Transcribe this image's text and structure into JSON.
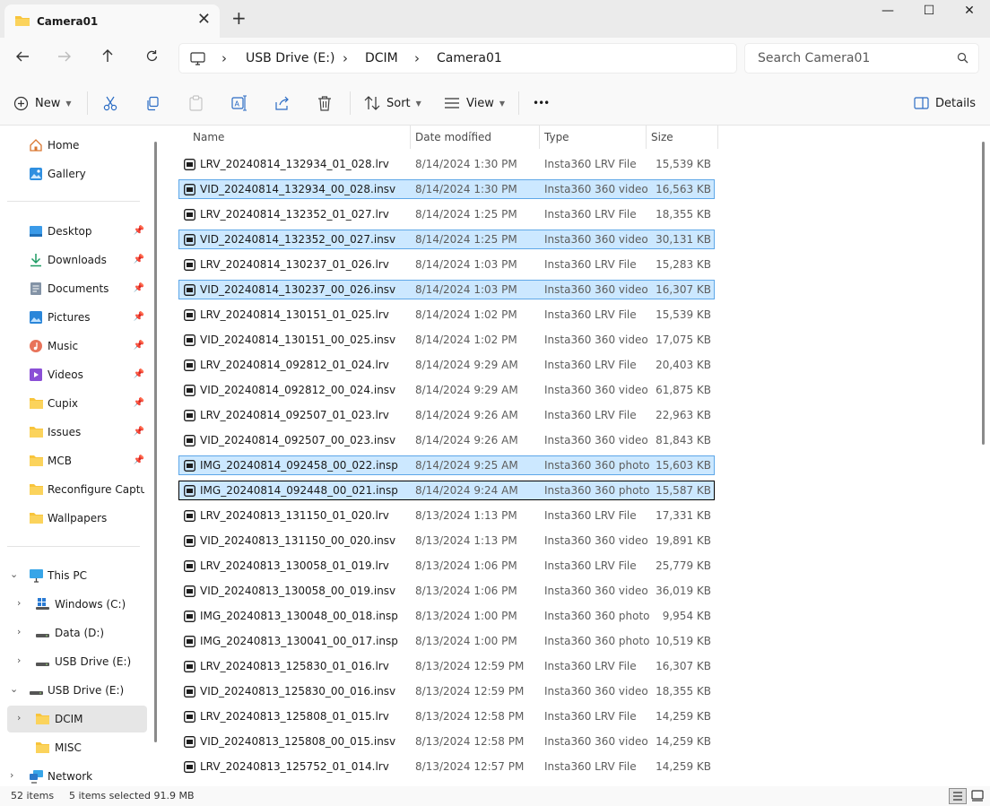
{
  "window": {
    "tab_title": "Camera01",
    "new_tab_glyph": "+",
    "close_glyph": "✕",
    "minimize": "—",
    "maximize": "☐",
    "close": "✕"
  },
  "address": {
    "crumbs": [
      "USB Drive (E:)",
      "DCIM",
      "Camera01"
    ],
    "search_placeholder": "Search Camera01"
  },
  "commands": {
    "new": "New",
    "sort": "Sort",
    "view": "View",
    "more": "•••",
    "details": "Details"
  },
  "nav": {
    "quick": [
      {
        "label": "Home",
        "icon": "home-icon"
      },
      {
        "label": "Gallery",
        "icon": "gallery-icon"
      }
    ],
    "pinned": [
      {
        "label": "Desktop",
        "icon": "desktop-icon"
      },
      {
        "label": "Downloads",
        "icon": "download-icon"
      },
      {
        "label": "Documents",
        "icon": "documents-icon"
      },
      {
        "label": "Pictures",
        "icon": "pictures-icon"
      },
      {
        "label": "Music",
        "icon": "music-icon"
      },
      {
        "label": "Videos",
        "icon": "videos-icon"
      },
      {
        "label": "Cupix",
        "icon": "folder-icon"
      },
      {
        "label": "Issues",
        "icon": "folder-icon"
      },
      {
        "label": "MCB",
        "icon": "folder-icon"
      },
      {
        "label": "Reconfigure Captu",
        "icon": "folder-icon"
      },
      {
        "label": "Wallpapers",
        "icon": "folder-icon"
      }
    ],
    "tree": [
      {
        "label": "This PC",
        "icon": "pc-icon"
      },
      {
        "label": "Windows (C:)",
        "icon": "windows-drive-icon"
      },
      {
        "label": "Data (D:)",
        "icon": "drive-icon"
      },
      {
        "label": "USB Drive (E:)",
        "icon": "drive-icon"
      },
      {
        "label": "USB Drive (E:)",
        "icon": "drive-icon"
      },
      {
        "label": "DCIM",
        "icon": "folder-icon"
      },
      {
        "label": "MISC",
        "icon": "folder-icon"
      },
      {
        "label": "Network",
        "icon": "network-icon"
      }
    ]
  },
  "columns": {
    "name": "Name",
    "date": "Date modified",
    "type": "Type",
    "size": "Size"
  },
  "files": [
    {
      "name": "LRV_20240814_132934_01_028.lrv",
      "date": "8/14/2024 1:30 PM",
      "type": "Insta360 LRV File",
      "size": "15,539 KB",
      "state": ""
    },
    {
      "name": "VID_20240814_132934_00_028.insv",
      "date": "8/14/2024 1:30 PM",
      "type": "Insta360 360 video",
      "size": "16,563 KB",
      "state": "sel"
    },
    {
      "name": "LRV_20240814_132352_01_027.lrv",
      "date": "8/14/2024 1:25 PM",
      "type": "Insta360 LRV File",
      "size": "18,355 KB",
      "state": ""
    },
    {
      "name": "VID_20240814_132352_00_027.insv",
      "date": "8/14/2024 1:25 PM",
      "type": "Insta360 360 video",
      "size": "30,131 KB",
      "state": "sel"
    },
    {
      "name": "LRV_20240814_130237_01_026.lrv",
      "date": "8/14/2024 1:03 PM",
      "type": "Insta360 LRV File",
      "size": "15,283 KB",
      "state": ""
    },
    {
      "name": "VID_20240814_130237_00_026.insv",
      "date": "8/14/2024 1:03 PM",
      "type": "Insta360 360 video",
      "size": "16,307 KB",
      "state": "sel"
    },
    {
      "name": "LRV_20240814_130151_01_025.lrv",
      "date": "8/14/2024 1:02 PM",
      "type": "Insta360 LRV File",
      "size": "15,539 KB",
      "state": ""
    },
    {
      "name": "VID_20240814_130151_00_025.insv",
      "date": "8/14/2024 1:02 PM",
      "type": "Insta360 360 video",
      "size": "17,075 KB",
      "state": ""
    },
    {
      "name": "LRV_20240814_092812_01_024.lrv",
      "date": "8/14/2024 9:29 AM",
      "type": "Insta360 LRV File",
      "size": "20,403 KB",
      "state": ""
    },
    {
      "name": "VID_20240814_092812_00_024.insv",
      "date": "8/14/2024 9:29 AM",
      "type": "Insta360 360 video",
      "size": "61,875 KB",
      "state": ""
    },
    {
      "name": "LRV_20240814_092507_01_023.lrv",
      "date": "8/14/2024 9:26 AM",
      "type": "Insta360 LRV File",
      "size": "22,963 KB",
      "state": ""
    },
    {
      "name": "VID_20240814_092507_00_023.insv",
      "date": "8/14/2024 9:26 AM",
      "type": "Insta360 360 video",
      "size": "81,843 KB",
      "state": ""
    },
    {
      "name": "IMG_20240814_092458_00_022.insp",
      "date": "8/14/2024 9:25 AM",
      "type": "Insta360 360 photo",
      "size": "15,603 KB",
      "state": "sel"
    },
    {
      "name": "IMG_20240814_092448_00_021.insp",
      "date": "8/14/2024 9:24 AM",
      "type": "Insta360 360 photo",
      "size": "15,587 KB",
      "state": "focus"
    },
    {
      "name": "LRV_20240813_131150_01_020.lrv",
      "date": "8/13/2024 1:13 PM",
      "type": "Insta360 LRV File",
      "size": "17,331 KB",
      "state": ""
    },
    {
      "name": "VID_20240813_131150_00_020.insv",
      "date": "8/13/2024 1:13 PM",
      "type": "Insta360 360 video",
      "size": "19,891 KB",
      "state": ""
    },
    {
      "name": "LRV_20240813_130058_01_019.lrv",
      "date": "8/13/2024 1:06 PM",
      "type": "Insta360 LRV File",
      "size": "25,779 KB",
      "state": ""
    },
    {
      "name": "VID_20240813_130058_00_019.insv",
      "date": "8/13/2024 1:06 PM",
      "type": "Insta360 360 video",
      "size": "36,019 KB",
      "state": ""
    },
    {
      "name": "IMG_20240813_130048_00_018.insp",
      "date": "8/13/2024 1:00 PM",
      "type": "Insta360 360 photo",
      "size": "9,954 KB",
      "state": ""
    },
    {
      "name": "IMG_20240813_130041_00_017.insp",
      "date": "8/13/2024 1:00 PM",
      "type": "Insta360 360 photo",
      "size": "10,519 KB",
      "state": ""
    },
    {
      "name": "LRV_20240813_125830_01_016.lrv",
      "date": "8/13/2024 12:59 PM",
      "type": "Insta360 LRV File",
      "size": "16,307 KB",
      "state": ""
    },
    {
      "name": "VID_20240813_125830_00_016.insv",
      "date": "8/13/2024 12:59 PM",
      "type": "Insta360 360 video",
      "size": "18,355 KB",
      "state": ""
    },
    {
      "name": "LRV_20240813_125808_01_015.lrv",
      "date": "8/13/2024 12:58 PM",
      "type": "Insta360 LRV File",
      "size": "14,259 KB",
      "state": ""
    },
    {
      "name": "VID_20240813_125808_00_015.insv",
      "date": "8/13/2024 12:58 PM",
      "type": "Insta360 360 video",
      "size": "14,259 KB",
      "state": ""
    },
    {
      "name": "LRV_20240813_125752_01_014.lrv",
      "date": "8/13/2024 12:57 PM",
      "type": "Insta360 LRV File",
      "size": "14,259 KB",
      "state": ""
    }
  ],
  "status": {
    "items": "52 items",
    "selected": "5 items selected  91.9 MB"
  },
  "colors": {
    "accent_folder": "#f8c43b",
    "selection": "#cce8ff",
    "selection_border": "#5ea7e8"
  }
}
